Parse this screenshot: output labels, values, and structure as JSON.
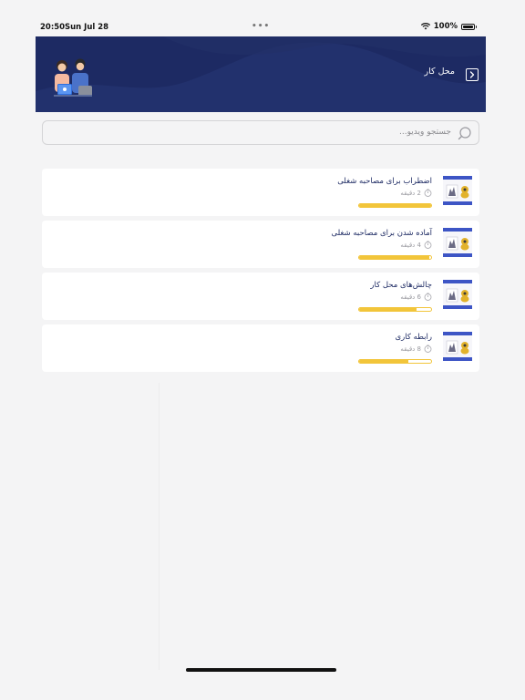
{
  "status_bar": {
    "time": "20:50",
    "date": "Sun Jul 28",
    "dots": "•••",
    "battery_text": "100%"
  },
  "header": {
    "title": "محل کار",
    "back_icon": "chevron-right-icon",
    "background_color": "#1d2a63"
  },
  "search": {
    "placeholder": "جستجو ویدیو..."
  },
  "videos": [
    {
      "title": "اضطراب برای مصاحبه شغلی",
      "duration": "2 دقیقه",
      "progress": 1.0
    },
    {
      "title": "آماده شدن برای مصاحبه شغلی",
      "duration": "4 دقیقه",
      "progress": 0.97
    },
    {
      "title": "چالش‌های محل کار",
      "duration": "6 دقیقه",
      "progress": 0.8
    },
    {
      "title": "رابطه کاری",
      "duration": "8 دقیقه",
      "progress": 0.68
    }
  ],
  "colors": {
    "accent": "#f2c53a",
    "title_text": "#1d2a63",
    "background": "#f4f4f5"
  }
}
